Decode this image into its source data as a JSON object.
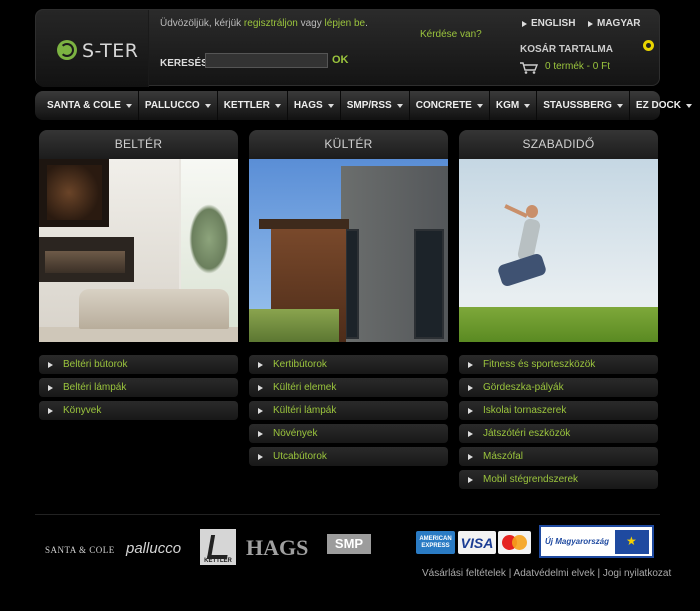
{
  "header": {
    "logo_text": "S-TER",
    "welcome_prefix": "Üdvözöljük, kérjük ",
    "register_link": "regisztráljon",
    "welcome_mid": " vagy ",
    "login_link": "lépjen be",
    "welcome_suffix": ".",
    "search_label": "KERESÉS",
    "search_value": "",
    "search_button": "OK",
    "question_link": "Kérdése van?",
    "lang_en": "ENGLISH",
    "lang_hu": "MAGYAR",
    "cart_title": "KOSÁR TARTALMA",
    "cart_summary": "0 termék - 0 Ft"
  },
  "nav": {
    "items": [
      {
        "label": "SANTA & COLE"
      },
      {
        "label": "PALLUCCO"
      },
      {
        "label": "KETTLER"
      },
      {
        "label": "HAGS"
      },
      {
        "label": "SMP/RSS"
      },
      {
        "label": "CONCRETE"
      },
      {
        "label": "KGM"
      },
      {
        "label": "STAUSSBERG"
      },
      {
        "label": "EZ DOCK"
      }
    ]
  },
  "columns": [
    {
      "title": "BELTÉR",
      "items": [
        "Beltéri bútorok",
        "Beltéri lámpák",
        "Könyvek"
      ]
    },
    {
      "title": "KÜLTÉR",
      "items": [
        "Kertibútorok",
        "Kültéri elemek",
        "Kültéri lámpák",
        "Növények",
        "Utcabútorok"
      ]
    },
    {
      "title": "SZABADIDŐ",
      "items": [
        "Fitness és sporteszközök",
        "Gördeszka-pályák",
        "Iskolai tornaszerek",
        "Játszótéri eszközök",
        "Mászófal",
        "Mobil stégrendszerek"
      ]
    }
  ],
  "footer": {
    "brands": {
      "santa": "SANTA & COLE",
      "pallucco": "pallucco",
      "kettler": "KETTLER",
      "hags": "HAGS",
      "smp": "SMP"
    },
    "cards": {
      "amex": "AMERICAN EXPRESS",
      "visa": "VISA",
      "mastercard": "MasterCard"
    },
    "uj_magyarorszag": "Új Magyarország",
    "links": {
      "terms": "Vásárlási feltételek",
      "sep1": " | ",
      "privacy": "Adatvédelmi elvek",
      "sep2": " | ",
      "legal": "Jogi nyilatkozat"
    }
  },
  "colors": {
    "accent": "#9bc53d",
    "background": "#000000"
  }
}
